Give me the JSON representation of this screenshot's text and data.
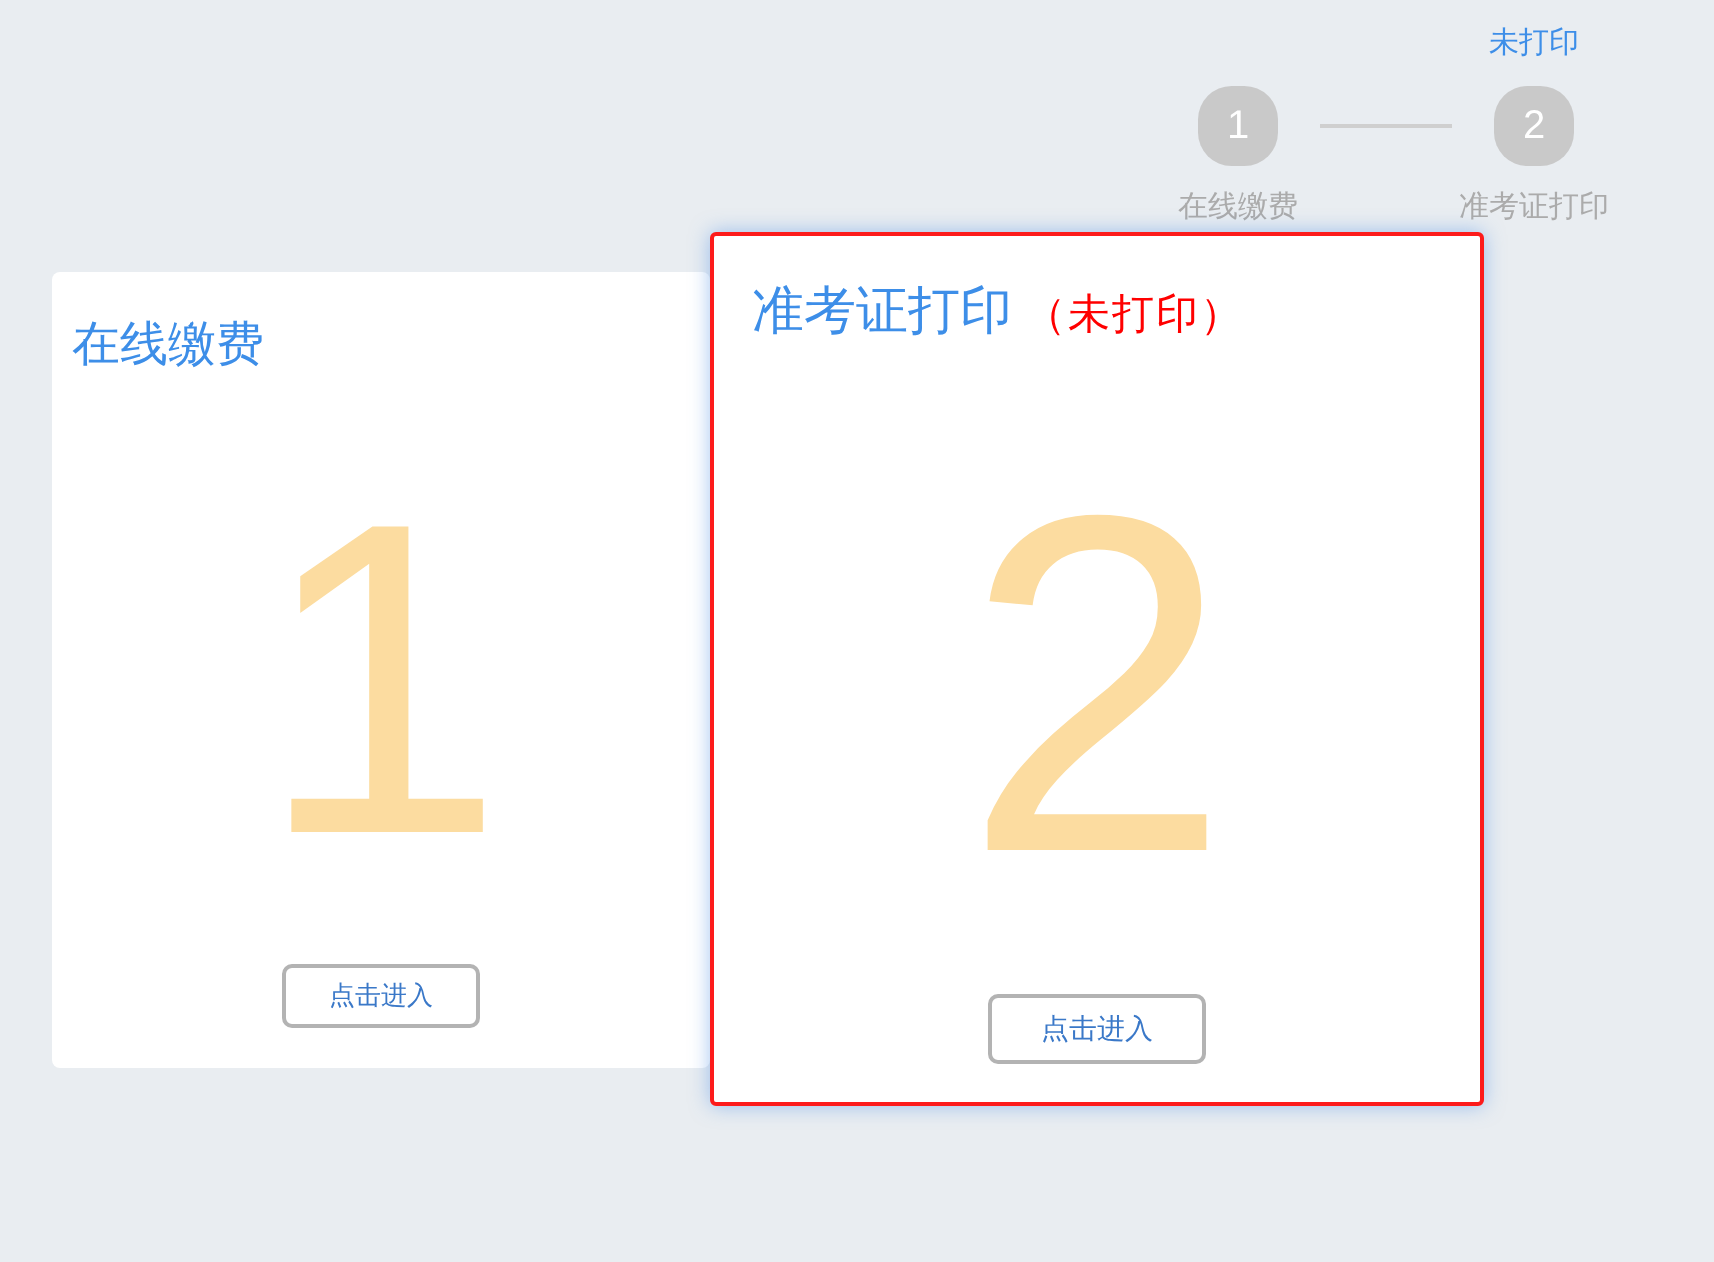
{
  "steps": [
    {
      "number": "1",
      "label": "在线缴费"
    },
    {
      "number": "2",
      "label": "准考证打印",
      "status": "未打印"
    }
  ],
  "cards": [
    {
      "title": "在线缴费",
      "number": "1",
      "button": "点击进入",
      "selected": false
    },
    {
      "title": "准考证打印",
      "status": "（未打印）",
      "number": "2",
      "button": "点击进入",
      "selected": true
    }
  ]
}
